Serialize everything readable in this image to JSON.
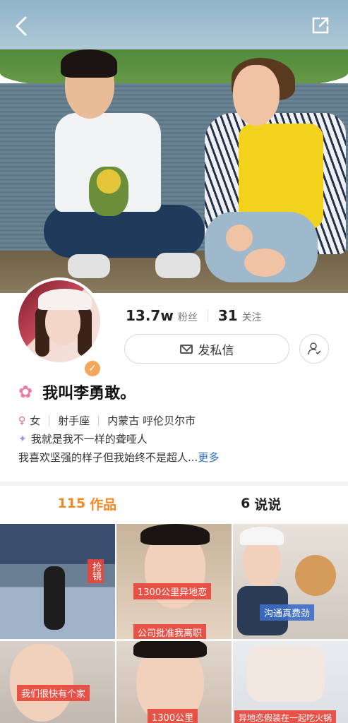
{
  "header": {
    "back_icon": "chevron-left-icon",
    "share_icon": "external-share-icon"
  },
  "profile": {
    "followers_count": "13.7w",
    "followers_label": "粉丝",
    "following_count": "31",
    "following_label": "关注",
    "message_button": "发私信",
    "name": "我叫李勇敢。",
    "gender": "女",
    "zodiac": "射手座",
    "location": "内蒙古 呼伦贝尔市",
    "bio_line1": "我就是我不一样的聋哑人",
    "bio_line2": "我喜欢坚强的样子但我始终不是超人...",
    "more_link": "更多"
  },
  "tabs": {
    "works_count": "115",
    "works_label": "作品",
    "posts_count": "6",
    "posts_label": "说说"
  },
  "grid": {
    "tile1_tag": "抢镜",
    "tile2_tag_top": "1300公里异地恋",
    "tile2_tag_bottom": "公司批准我离职",
    "tile3_tag": "沟通真费劲",
    "tile4_tag": "我们很快有个家",
    "tile5_tag": "1300公里",
    "tile6_tag": "异地恋假装在一起吃火锅"
  },
  "colors": {
    "accent": "#f08a24",
    "link": "#2c6cc4",
    "tag_red": "#e8463c"
  }
}
